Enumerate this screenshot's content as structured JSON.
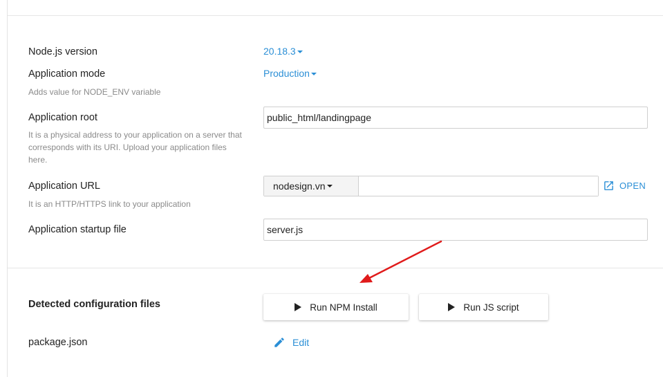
{
  "form": {
    "node_version": {
      "label": "Node.js version",
      "value": "20.18.3"
    },
    "app_mode": {
      "label": "Application mode",
      "value": "Production",
      "hint": "Adds value for NODE_ENV variable"
    },
    "app_root": {
      "label": "Application root",
      "value": "public_html/landingpage",
      "hint": "It is a physical address to your application on a server that corresponds with its URI. Upload your application files here."
    },
    "app_url": {
      "label": "Application URL",
      "domain": "nodesign.vn",
      "path": "",
      "hint": "It is an HTTP/HTTPS link to your application",
      "open_label": "OPEN"
    },
    "startup_file": {
      "label": "Application startup file",
      "value": "server.js"
    }
  },
  "config": {
    "title": "Detected configuration files",
    "run_npm_label": "Run NPM Install",
    "run_js_label": "Run JS script",
    "file_name": "package.json",
    "edit_label": "Edit"
  },
  "colors": {
    "accent": "#2b8fd6",
    "annotation_arrow": "#e01b1b"
  }
}
